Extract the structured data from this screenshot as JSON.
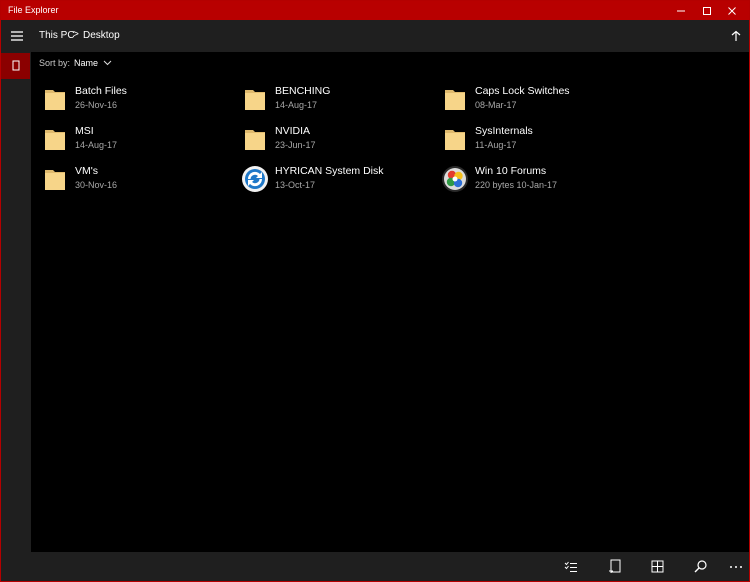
{
  "window": {
    "title": "File Explorer",
    "accent_color": "#b80000"
  },
  "titlebar_buttons": [
    "minimize-icon",
    "maximize-icon",
    "close-icon"
  ],
  "breadcrumb": {
    "items": [
      "This PC",
      "Desktop"
    ],
    "separator": ">"
  },
  "sort": {
    "label": "Sort by:",
    "value": "Name"
  },
  "files": [
    {
      "name": "Batch Files",
      "meta": "26-Nov-16",
      "icon": "folder-icon"
    },
    {
      "name": "BENCHING",
      "meta": "14-Aug-17",
      "icon": "folder-icon"
    },
    {
      "name": "Caps Lock Switches",
      "meta": "08-Mar-17",
      "icon": "folder-icon"
    },
    {
      "name": "MSI",
      "meta": "14-Aug-17",
      "icon": "folder-icon"
    },
    {
      "name": "NVIDIA",
      "meta": "23-Jun-17",
      "icon": "folder-icon"
    },
    {
      "name": "SysInternals",
      "meta": "11-Aug-17",
      "icon": "folder-icon"
    },
    {
      "name": "VM's",
      "meta": "30-Nov-16",
      "icon": "folder-icon"
    },
    {
      "name": "HYRICAN System Disk",
      "meta": "13-Oct-17",
      "icon": "disk-app-icon"
    },
    {
      "name": "Win 10 Forums",
      "meta": "220 bytes 10-Jan-17",
      "icon": "chrome-shortcut-icon"
    }
  ],
  "bottom_toolbar": [
    "select-icon",
    "new-item-icon",
    "view-icon",
    "search-icon",
    "more-icon"
  ]
}
